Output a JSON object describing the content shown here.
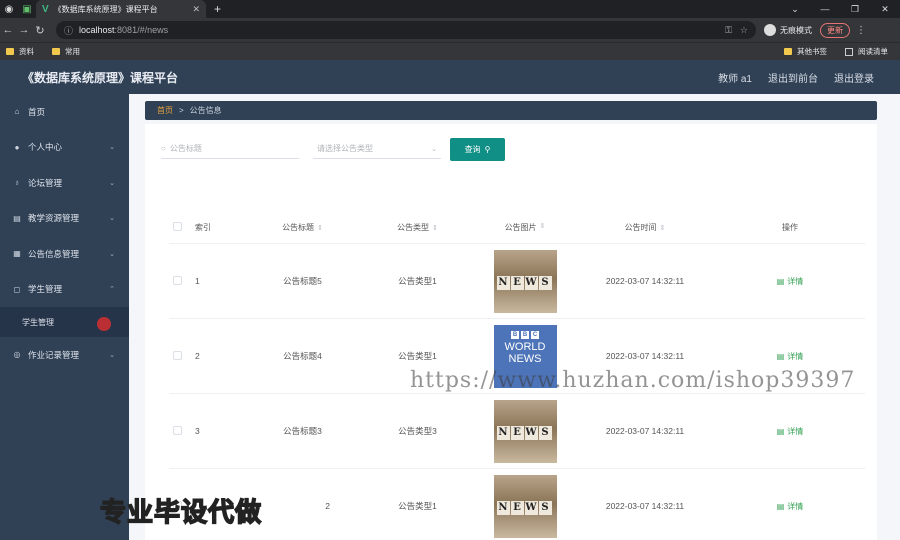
{
  "browser": {
    "tab_title": "《数据库系统原理》课程平台",
    "url_host": "localhost",
    "url_path": ":8081/#/news",
    "incognito_label": "无痕模式",
    "update_label": "更新",
    "bookmarks": [
      "资料",
      "常用"
    ],
    "bookmarks_right": [
      "其他书签",
      "阅读清单"
    ]
  },
  "header": {
    "title": "《数据库系统原理》课程平台",
    "user": "教师 a1",
    "back_front": "退出到前台",
    "logout": "退出登录"
  },
  "sidebar": {
    "items": [
      {
        "label": "首页",
        "icon": "home-icon"
      },
      {
        "label": "个人中心",
        "icon": "user-icon"
      },
      {
        "label": "论坛管理",
        "icon": "mic-icon"
      },
      {
        "label": "教学资源管理",
        "icon": "briefcase-icon"
      },
      {
        "label": "公告信息管理",
        "icon": "grid-icon"
      },
      {
        "label": "学生管理",
        "icon": "crop-icon"
      },
      {
        "label": "作业记录管理",
        "icon": "compass-icon"
      }
    ],
    "sub_item": "学生管理"
  },
  "breadcrumb": {
    "home": "首页",
    "sep": ">",
    "current": "公告信息"
  },
  "search": {
    "title_placeholder": "公告标题",
    "type_placeholder": "请选择公告类型",
    "button_label": "查询"
  },
  "table": {
    "headers": [
      "索引",
      "公告标题",
      "公告类型",
      "公告图片",
      "公告时间",
      "操作"
    ],
    "rows": [
      {
        "index": "1",
        "title": "公告标题5",
        "type": "公告类型1",
        "image": "news-tiles",
        "time": "2022-03-07 14:32:11",
        "action": "详情"
      },
      {
        "index": "2",
        "title": "公告标题4",
        "type": "公告类型1",
        "image": "bbc-world-news",
        "time": "2022-03-07 14:32:11",
        "action": "详情"
      },
      {
        "index": "3",
        "title": "公告标题3",
        "type": "公告类型3",
        "image": "news-tiles",
        "time": "2022-03-07 14:32:11",
        "action": "详情"
      },
      {
        "index": "",
        "title": "2",
        "type": "公告类型1",
        "image": "news-tiles",
        "time": "2022-03-07 14:32:11",
        "action": "详情"
      }
    ],
    "news_letters": [
      "N",
      "E",
      "W",
      "S"
    ],
    "bbc_letters": [
      "B",
      "B",
      "C"
    ],
    "world_text": "WORLD",
    "world_news_text": "NEWS"
  },
  "watermarks": {
    "url": "https://www.huzhan.com/ishop39397",
    "slogan": "专业毕设代做"
  },
  "colors": {
    "sidebar": "#304156",
    "primary_button": "#0f8f85",
    "breadcrumb_home": "#e6a23c",
    "detail_link": "#2e9e4f"
  }
}
